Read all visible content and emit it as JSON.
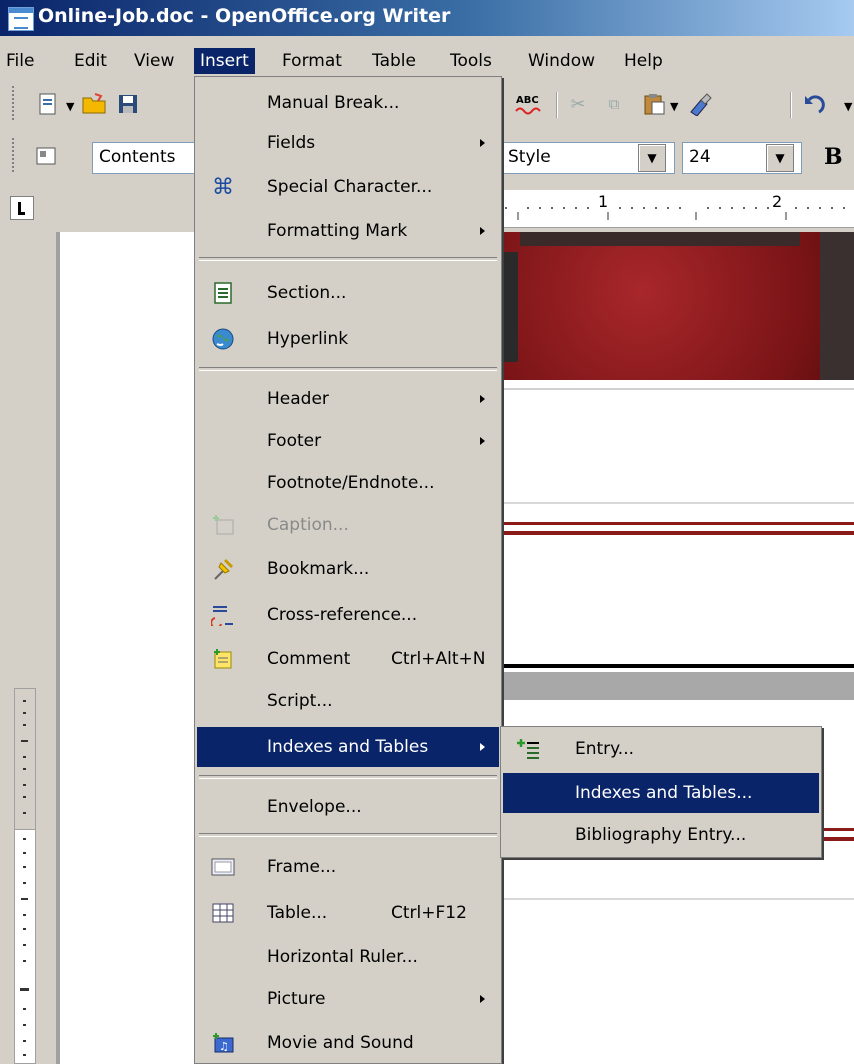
{
  "window": {
    "title": "Online-Job.doc - OpenOffice.org Writer"
  },
  "menubar": {
    "items": [
      "File",
      "Edit",
      "View",
      "Insert",
      "Format",
      "Table",
      "Tools",
      "Window",
      "Help"
    ]
  },
  "toolbar": {
    "para_style": "Contents",
    "font_name": "Style",
    "font_size": "24",
    "bold_label": "B",
    "spell_label": "ABC"
  },
  "ruler": {
    "mark1": "1",
    "mark2": "2"
  },
  "insert_menu": {
    "items": [
      {
        "label": "Manual Break..."
      },
      {
        "label": "Fields"
      },
      {
        "label": "Special Character..."
      },
      {
        "label": "Formatting Mark"
      },
      {
        "label": "Section..."
      },
      {
        "label": "Hyperlink"
      },
      {
        "label": "Header"
      },
      {
        "label": "Footer"
      },
      {
        "label": "Footnote/Endnote..."
      },
      {
        "label": "Caption..."
      },
      {
        "label": "Bookmark..."
      },
      {
        "label": "Cross-reference..."
      },
      {
        "label": "Comment",
        "accel": "Ctrl+Alt+N"
      },
      {
        "label": "Script..."
      },
      {
        "label": "Indexes and Tables"
      },
      {
        "label": "Envelope..."
      },
      {
        "label": "Frame..."
      },
      {
        "label": "Table...",
        "accel": "Ctrl+F12"
      },
      {
        "label": "Horizontal Ruler..."
      },
      {
        "label": "Picture"
      },
      {
        "label": "Movie and Sound"
      }
    ]
  },
  "submenu": {
    "items": [
      {
        "label": "Entry..."
      },
      {
        "label": "Indexes and Tables..."
      },
      {
        "label": "Bibliography Entry..."
      }
    ]
  },
  "colors": {
    "highlight": "#0a246a",
    "menu_bg": "#d4d0c8",
    "accent_red": "#8b1a1a"
  }
}
